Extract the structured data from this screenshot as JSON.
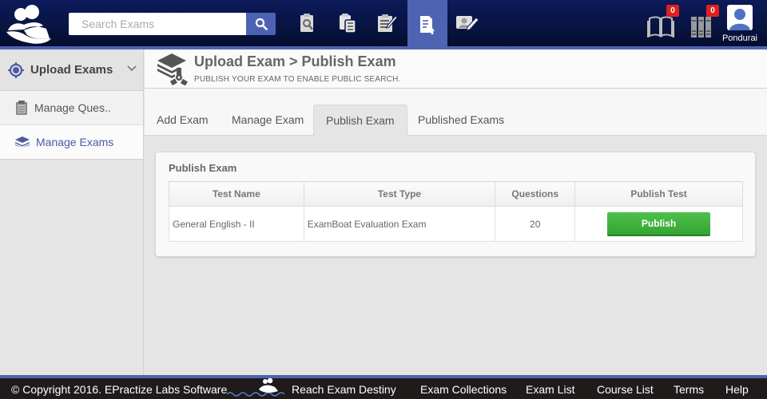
{
  "header": {
    "logo_icon": "family-boat-logo-icon",
    "search": {
      "placeholder": "Search Exams",
      "value": "",
      "button_icon": "search-icon"
    },
    "nav_icons": [
      {
        "name": "search-exam-icon",
        "active": false
      },
      {
        "name": "clipboard-list-icon",
        "active": false
      },
      {
        "name": "checklist-edit-icon",
        "active": false
      },
      {
        "name": "upload-document-icon",
        "active": true
      },
      {
        "name": "profile-edit-icon",
        "active": false
      }
    ],
    "notifications": [
      {
        "icon": "book-icon",
        "count": "0"
      },
      {
        "icon": "library-icon",
        "count": "0"
      }
    ],
    "user": {
      "name": "Pondurai",
      "icon": "user-avatar-icon"
    }
  },
  "sidebar": {
    "section": {
      "label": "Upload Exams",
      "icon": "crosshair-icon",
      "chevron": "chevron-down-icon"
    },
    "items": [
      {
        "label": "Manage Ques..",
        "icon": "clipboard-icon",
        "active": false
      },
      {
        "label": "Manage Exams",
        "icon": "stack-icon",
        "active": true
      }
    ]
  },
  "page": {
    "title": "Upload Exam > Publish Exam",
    "subtitle": "PUBLISH YOUR EXAM TO ENABLE PUBLIC SEARCH.",
    "icon": "upload-stack-icon"
  },
  "tabs": [
    {
      "label": "Add Exam",
      "active": false
    },
    {
      "label": "Manage Exam",
      "active": false
    },
    {
      "label": "Publish Exam",
      "active": true
    },
    {
      "label": "Published Exams",
      "active": false
    }
  ],
  "publish_card": {
    "title": "Publish Exam",
    "columns": [
      "Test Name",
      "Test Type",
      "Questions",
      "Publish Test"
    ],
    "rows": [
      {
        "test_name": "General English - II",
        "test_type": "ExamBoat Evaluation Exam",
        "questions": "20",
        "action_label": "Publish"
      }
    ]
  },
  "footer": {
    "copyright": "© Copyright 2016. EPractize Labs Software",
    "tagline": "Reach Exam Destiny",
    "links": [
      "Exam Collections",
      "Exam List",
      "Course List",
      "Terms",
      "Help"
    ]
  },
  "colors": {
    "header_bg": "#0a1650",
    "accent": "#4f63b3",
    "active_link": "#4a5aa6",
    "publish_green": "#3cb239",
    "badge_red": "#e02020",
    "footer_bg": "#1f1b1b"
  }
}
